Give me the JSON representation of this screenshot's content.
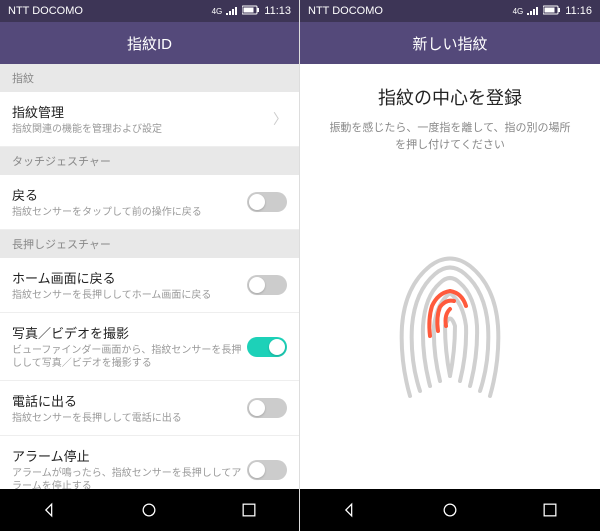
{
  "left": {
    "statusbar": {
      "carrier": "NTT DOCOMO",
      "network": "4G",
      "time": "11:13"
    },
    "title": "指紋ID",
    "sections": {
      "s1": "指紋",
      "s2": "タッチジェスチャー",
      "s3": "長押しジェスチャー"
    },
    "items": {
      "manage": {
        "title": "指紋管理",
        "subtitle": "指紋関連の機能を管理および設定"
      },
      "back": {
        "title": "戻る",
        "subtitle": "指紋センサーをタップして前の操作に戻る"
      },
      "home": {
        "title": "ホーム画面に戻る",
        "subtitle": "指紋センサーを長押ししてホーム画面に戻る"
      },
      "photo": {
        "title": "写真／ビデオを撮影",
        "subtitle": "ビューファインダー画面から、指紋センサーを長押しして写真／ビデオを撮影する"
      },
      "call": {
        "title": "電話に出る",
        "subtitle": "指紋センサーを長押しして電話に出る"
      },
      "alarm": {
        "title": "アラーム停止",
        "subtitle": "アラームが鳴ったら、指紋センサーを長押ししてアラームを停止する"
      }
    }
  },
  "right": {
    "statusbar": {
      "carrier": "NTT DOCOMO",
      "network": "4G",
      "time": "11:16"
    },
    "title": "新しい指紋",
    "enroll": {
      "heading": "指紋の中心を登録",
      "desc": "振動を感じたら、一度指を離して、指の別の場所を押し付けてください"
    }
  },
  "colors": {
    "accent": "#1dd1b8",
    "highlight": "#ff5a3c"
  }
}
